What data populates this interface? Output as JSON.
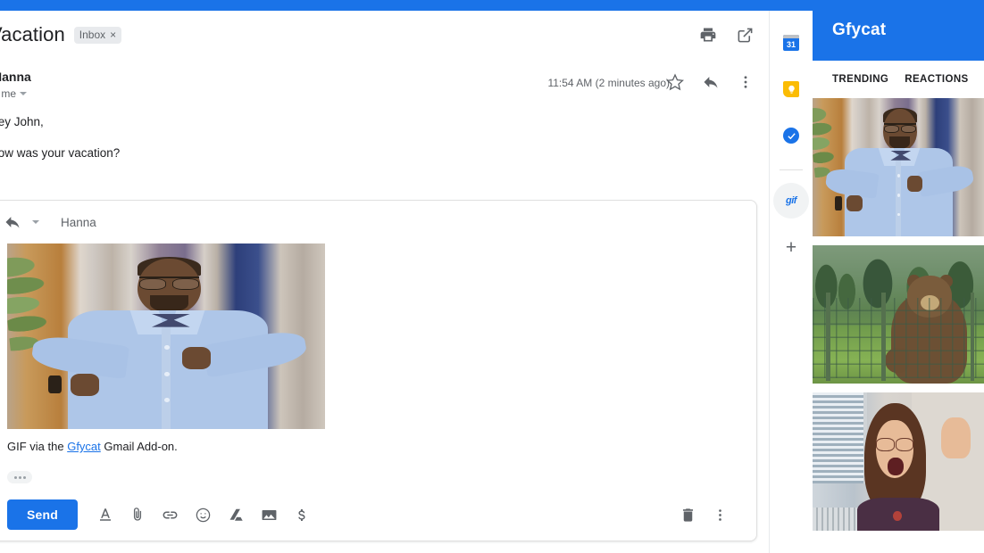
{
  "window": {
    "accent_color": "#1a73e8"
  },
  "mail": {
    "subject": "Vacation",
    "label_chip": "Inbox",
    "label_chip_close": "×",
    "sender": "Hanna",
    "recipient_line": "to me",
    "timestamp": "11:54 AM (2 minutes ago)",
    "body_lines": [
      "Hey John,",
      "How was your vacation?"
    ],
    "header_icons": [
      "print-icon",
      "open-in-new-window-icon"
    ],
    "message_icons": [
      "star-icon",
      "reply-icon",
      "more-vert-icon"
    ]
  },
  "reply": {
    "recipient": "Hanna",
    "reply_icon": "reply-icon",
    "dropdown_icon": "chevron-down-icon",
    "gif_alt": "man in light blue shirt and bow tie dancing",
    "caption_prefix": "GIF via the ",
    "caption_link": "Gfycat",
    "caption_suffix": " Gmail Add-on.",
    "trimmed_content_label": "…",
    "send_label": "Send",
    "toolbar_icons": [
      "format-text-icon",
      "attach-file-icon",
      "insert-link-icon",
      "insert-emoji-icon",
      "google-drive-icon",
      "insert-photo-icon",
      "insert-money-icon"
    ],
    "toolbar_right_icons": [
      "discard-draft-icon",
      "more-options-icon"
    ]
  },
  "addon_rail": {
    "items": [
      {
        "name": "google-calendar",
        "icon": "calendar-icon",
        "badge": "31",
        "selected": false
      },
      {
        "name": "google-keep",
        "icon": "keep-lightbulb-icon",
        "selected": false
      },
      {
        "name": "google-tasks",
        "icon": "tasks-check-icon",
        "selected": false
      },
      {
        "name": "gfycat-addon",
        "icon": "gif-icon",
        "label": "gif",
        "selected": true
      }
    ],
    "add_label": "+"
  },
  "gfycat": {
    "title": "Gfycat",
    "tabs": [
      {
        "label": "TRENDING",
        "active": true
      },
      {
        "label": "REACTIONS",
        "active": false
      }
    ],
    "search_icon": "search-icon",
    "thumbnails": [
      {
        "id": "gif-thumb-1",
        "alt": "man in light blue shirt with bow tie dancing",
        "scene": "A"
      },
      {
        "id": "gif-thumb-2",
        "alt": "brown bear standing behind a wire fence",
        "scene": "B"
      },
      {
        "id": "gif-thumb-3",
        "alt": "woman with glasses cheering with raised hand",
        "scene": "C"
      }
    ]
  }
}
